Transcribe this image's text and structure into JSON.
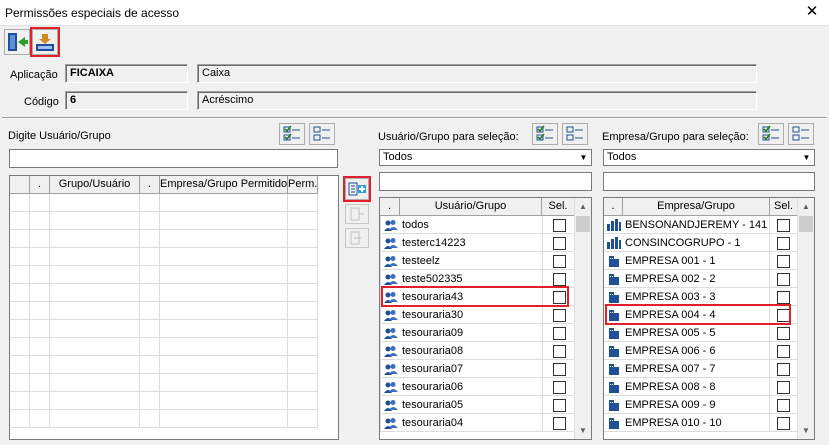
{
  "window": {
    "title": "Permissões especiais de acesso",
    "close": "✕"
  },
  "app": {
    "label": "Aplicação",
    "code": "FICAIXA",
    "desc": "Caixa"
  },
  "codigo": {
    "label": "Código",
    "value": "6",
    "desc": "Acréscimo"
  },
  "left_panel": {
    "label": "Digite Usuário/Grupo",
    "columns": [
      ".",
      "Grupo/Usuário",
      ".",
      "Empresa/Grupo Permitido",
      "Perm."
    ]
  },
  "users_panel": {
    "label": "Usuário/Grupo para seleção:",
    "combo": "Todos",
    "columns": [
      ".",
      "Usuário/Grupo",
      "Sel."
    ],
    "rows": [
      "todos",
      "testerc14223",
      "testeelz",
      "teste502335",
      "tesouraria43",
      "tesouraria30",
      "tesouraria09",
      "tesouraria08",
      "tesouraria07",
      "tesouraria06",
      "tesouraria05",
      "tesouraria04"
    ]
  },
  "company_panel": {
    "label": "Empresa/Grupo para seleção:",
    "combo": "Todos",
    "columns": [
      ".",
      "Empresa/Grupo",
      "Sel."
    ],
    "rows": [
      {
        "name": "BENSONANDJEREMY - 141",
        "icon": "group"
      },
      {
        "name": "CONSINCOGRUPO - 1",
        "icon": "group"
      },
      {
        "name": "EMPRESA 001 - 1",
        "icon": "building"
      },
      {
        "name": "EMPRESA 002 - 2",
        "icon": "building"
      },
      {
        "name": "EMPRESA 003 - 3",
        "icon": "building"
      },
      {
        "name": "EMPRESA 004 - 4",
        "icon": "building"
      },
      {
        "name": "EMPRESA 005 - 5",
        "icon": "building"
      },
      {
        "name": "EMPRESA 006 - 6",
        "icon": "building"
      },
      {
        "name": "EMPRESA 007 - 7",
        "icon": "building"
      },
      {
        "name": "EMPRESA 008 - 8",
        "icon": "building"
      },
      {
        "name": "EMPRESA 009 - 9",
        "icon": "building"
      },
      {
        "name": "EMPRESA 010 - 10",
        "icon": "building"
      }
    ]
  },
  "icons": {
    "exit": "exit-door-icon",
    "save": "save-icon",
    "check_all": "check-all-icon",
    "uncheck_all": "uncheck-all-icon",
    "add": "add-permission-icon",
    "user_group": "user-group-icon",
    "company_group": "company-group-icon",
    "company": "building-icon"
  },
  "colors": {
    "highlight": "#e0202a",
    "icon_blue": "#1f4f9a"
  }
}
